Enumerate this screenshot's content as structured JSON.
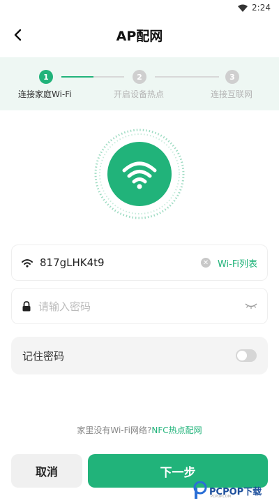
{
  "status_bar": {
    "time": "2:24"
  },
  "header": {
    "title": "AP配网"
  },
  "stepper": {
    "steps": [
      {
        "num": "1",
        "label": "连接家庭Wi-Fi"
      },
      {
        "num": "2",
        "label": "开启设备热点"
      },
      {
        "num": "3",
        "label": "连接互联网"
      }
    ],
    "current_step": 1
  },
  "wifi_field": {
    "ssid": "817gLHK4t9",
    "list_link": "Wi-Fi列表"
  },
  "password_field": {
    "placeholder": "请输入密码"
  },
  "remember": {
    "label": "记住密码",
    "enabled": false
  },
  "hint": {
    "text": "家里没有Wi-Fi网络?",
    "link": "NFC热点配网"
  },
  "buttons": {
    "cancel": "取消",
    "next": "下一步"
  },
  "watermark": {
    "brand": "PCPOP下载",
    "sub": "PCPOP.COM"
  },
  "colors": {
    "accent": "#21b37a",
    "accent_light": "#eef7f3",
    "inactive": "#cfcfcf"
  },
  "icons": [
    "back-arrow-icon",
    "wifi-icon",
    "clear-icon",
    "lock-icon",
    "eye-closed-icon",
    "toggle-switch"
  ]
}
